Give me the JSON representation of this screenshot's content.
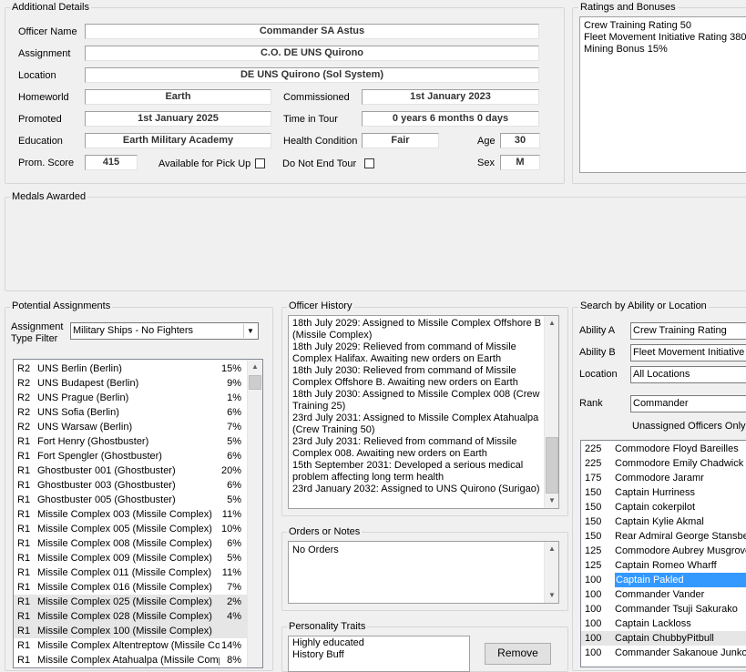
{
  "details": {
    "title": "Additional Details",
    "officer_name_label": "Officer Name",
    "officer_name": "Commander SA Astus",
    "assignment_label": "Assignment",
    "assignment": "C.O. DE UNS Quirono",
    "location_label": "Location",
    "location": "DE UNS Quirono (Sol System)",
    "homeworld_label": "Homeworld",
    "homeworld": "Earth",
    "commissioned_label": "Commissioned",
    "commissioned": "1st January 2023",
    "promoted_label": "Promoted",
    "promoted": "1st January 2025",
    "time_in_tour_label": "Time in Tour",
    "time_in_tour": "0 years 6 months 0 days",
    "education_label": "Education",
    "education": "Earth Military Academy",
    "health_label": "Health Condition",
    "health": "Fair",
    "age_label": "Age",
    "age": "30",
    "prom_score_label": "Prom. Score",
    "prom_score": "415",
    "pickup_label": "Available for Pick Up",
    "no_end_tour_label": "Do Not End Tour",
    "sex_label": "Sex",
    "sex": "M"
  },
  "ratings": {
    "title": "Ratings and Bonuses",
    "lines": [
      "Crew Training Rating 50",
      "Fleet Movement Initiative Rating 380",
      "Mining Bonus 15%"
    ]
  },
  "medals": {
    "title": "Medals Awarded"
  },
  "potential": {
    "title": "Potential Assignments",
    "filter_label_1": "Assignment",
    "filter_label_2": "Type Filter",
    "filter_value": "Military Ships - No Fighters",
    "rows": [
      {
        "prefix": "R2",
        "name": "UNS Berlin (Berlin)",
        "pct": "15%"
      },
      {
        "prefix": "R2",
        "name": "UNS Budapest (Berlin)",
        "pct": "9%"
      },
      {
        "prefix": "R2",
        "name": "UNS Prague (Berlin)",
        "pct": "1%"
      },
      {
        "prefix": "R2",
        "name": "UNS Sofia (Berlin)",
        "pct": "6%"
      },
      {
        "prefix": "R2",
        "name": "UNS Warsaw (Berlin)",
        "pct": "7%"
      },
      {
        "prefix": "R1",
        "name": "Fort Henry (Ghostbuster)",
        "pct": "5%"
      },
      {
        "prefix": "R1",
        "name": "Fort Spengler (Ghostbuster)",
        "pct": "6%"
      },
      {
        "prefix": "R1",
        "name": "Ghostbuster 001 (Ghostbuster)",
        "pct": "20%"
      },
      {
        "prefix": "R1",
        "name": "Ghostbuster 003 (Ghostbuster)",
        "pct": "6%"
      },
      {
        "prefix": "R1",
        "name": "Ghostbuster 005 (Ghostbuster)",
        "pct": "5%"
      },
      {
        "prefix": "R1",
        "name": "Missile Complex 003 (Missile Complex)",
        "pct": "11%"
      },
      {
        "prefix": "R1",
        "name": "Missile Complex 005 (Missile Complex)",
        "pct": "10%"
      },
      {
        "prefix": "R1",
        "name": "Missile Complex 008 (Missile Complex)",
        "pct": "6%"
      },
      {
        "prefix": "R1",
        "name": "Missile Complex 009 (Missile Complex)",
        "pct": "5%"
      },
      {
        "prefix": "R1",
        "name": "Missile Complex 011 (Missile Complex)",
        "pct": "11%"
      },
      {
        "prefix": "R1",
        "name": "Missile Complex 016 (Missile Complex)",
        "pct": "7%"
      },
      {
        "prefix": "R1",
        "name": "Missile Complex 025 (Missile Complex)",
        "pct": "2%"
      },
      {
        "prefix": "R1",
        "name": "Missile Complex 028 (Missile Complex)",
        "pct": "4%"
      },
      {
        "prefix": "R1",
        "name": "Missile Complex 100 (Missile Complex)",
        "pct": ""
      },
      {
        "prefix": "R1",
        "name": "Missile Complex Altentreptow (Missile Com",
        "pct": "14%"
      },
      {
        "prefix": "R1",
        "name": "Missile Complex Atahualpa (Missile Compl",
        "pct": "8%"
      }
    ]
  },
  "history": {
    "title": "Officer History",
    "lines": [
      "18th July 2029: Assigned to Missile Complex Offshore B",
      "(Missile Complex)",
      "18th July 2029: Relieved from command of Missile",
      "Complex Halifax. Awaiting new orders on Earth",
      "18th July 2030: Relieved from command of Missile",
      "Complex Offshore B. Awaiting new orders on Earth",
      "18th July 2030: Assigned to Missile Complex 008 (Crew",
      "Training 25)",
      "23rd July 2031: Assigned to Missile Complex Atahualpa",
      "(Crew Training 50)",
      "23rd July 2031: Relieved from command of Missile",
      "Complex 008. Awaiting new orders on Earth",
      "15th September 2031: Developed a serious medical",
      "problem affecting long term health",
      "23rd January 2032: Assigned to UNS Quirono (Surigao)"
    ]
  },
  "orders": {
    "title": "Orders or Notes",
    "text": "No Orders"
  },
  "traits": {
    "title": "Personality Traits",
    "lines": [
      "Highly educated",
      "History Buff"
    ],
    "remove_label": "Remove"
  },
  "search": {
    "title": "Search by Ability or Location",
    "ability_a_label": "Ability A",
    "ability_a": "Crew Training Rating",
    "ability_b_label": "Ability B",
    "ability_b": "Fleet Movement Initiative R",
    "location_label": "Location",
    "location": "All Locations",
    "rank_label": "Rank",
    "rank": "Commander",
    "unassigned_label": "Unassigned Officers Only",
    "officers": [
      {
        "score": "225",
        "name": "Commodore Floyd Bareilles"
      },
      {
        "score": "225",
        "name": "Commodore Emily Chadwick"
      },
      {
        "score": "175",
        "name": "Commodore Jaramr"
      },
      {
        "score": "150",
        "name": "Captain Hurriness"
      },
      {
        "score": "150",
        "name": "Captain cokerpilot"
      },
      {
        "score": "150",
        "name": "Captain Kylie Akmal"
      },
      {
        "score": "150",
        "name": "Rear Admiral George Stansber"
      },
      {
        "score": "125",
        "name": "Commodore Aubrey Musgrove"
      },
      {
        "score": "125",
        "name": "Captain Romeo Wharff"
      },
      {
        "score": "100",
        "name": "Captain Pakled"
      },
      {
        "score": "100",
        "name": "Commander Vander"
      },
      {
        "score": "100",
        "name": "Commander Tsuji Sakurako"
      },
      {
        "score": "100",
        "name": "Captain Lackloss"
      },
      {
        "score": "100",
        "name": "Captain ChubbyPitbull"
      },
      {
        "score": "100",
        "name": "Commander Sakanoue Junko"
      }
    ]
  }
}
